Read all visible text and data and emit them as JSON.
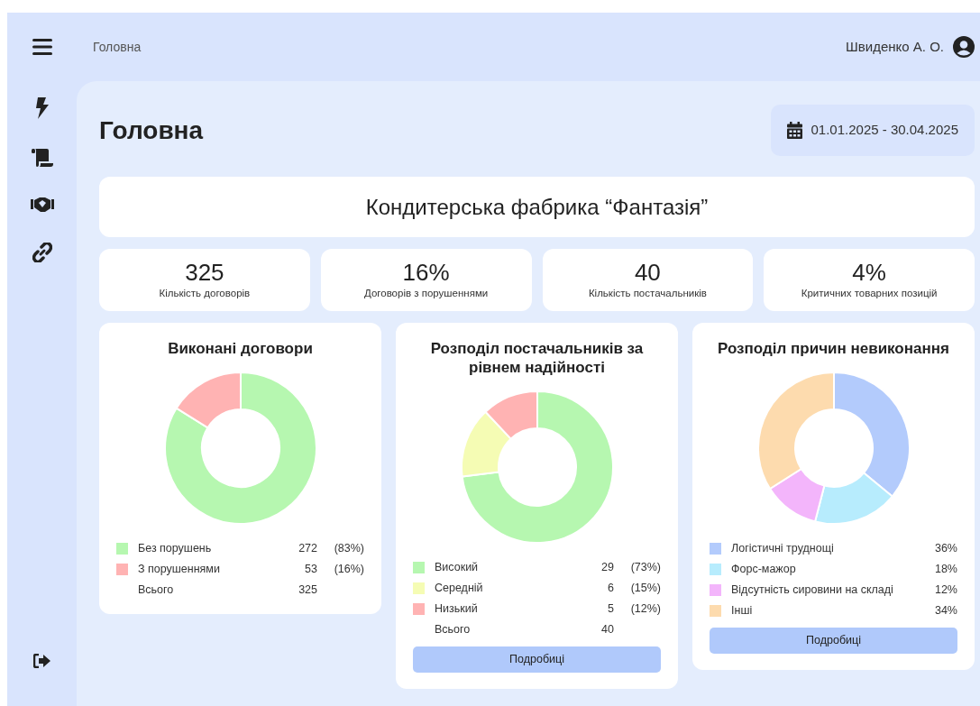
{
  "header": {
    "breadcrumb": "Головна",
    "user": "Швиденко А. О."
  },
  "page": {
    "title": "Головна",
    "date_range": "01.01.2025 - 30.04.2025"
  },
  "company": "Кондитерська фабрика “Фантазія”",
  "stats": [
    {
      "value": "325",
      "label": "Кількість договорів"
    },
    {
      "value": "16%",
      "label": "Договорів з порушеннями"
    },
    {
      "value": "40",
      "label": "Кількість постачальників"
    },
    {
      "value": "4%",
      "label": "Критичних товарних позицій"
    }
  ],
  "cards": [
    {
      "title": "Виконані договори",
      "chart_data": {
        "type": "donut",
        "categories": [
          "Без порушень",
          "З порушеннями"
        ],
        "values": [
          83,
          16
        ]
      },
      "legend": [
        {
          "color": "#b6f7b0",
          "count": "272",
          "percent": "(83%)"
        },
        {
          "color": "#ffb3b3",
          "count": "53",
          "percent": "(16%)"
        }
      ],
      "total": {
        "label": "Всього",
        "count": "325"
      }
    },
    {
      "title": "Розподіл постачальників за рівнем надійності",
      "chart_data": {
        "type": "donut",
        "categories": [
          "Високий",
          "Середній",
          "Низький"
        ],
        "values": [
          73,
          15,
          12
        ]
      },
      "legend": [
        {
          "color": "#b6f7b0",
          "count": "29",
          "percent": "(73%)"
        },
        {
          "color": "#f5fcb4",
          "count": "6",
          "percent": "(15%)"
        },
        {
          "color": "#ffb3b3",
          "count": "5",
          "percent": "(12%)"
        }
      ],
      "total": {
        "label": "Всього",
        "count": "40"
      },
      "button": "Подробиці"
    },
    {
      "title": "Розподіл причин невиконання",
      "chart_data": {
        "type": "donut",
        "categories": [
          "Логістичні труднощі",
          "Форс-мажор",
          "Відсутність сировини на складі",
          "Інші"
        ],
        "values": [
          36,
          18,
          12,
          34
        ]
      },
      "legend": [
        {
          "color": "#b3cbfc",
          "percent": "36%"
        },
        {
          "color": "#b7ecfd",
          "percent": "18%"
        },
        {
          "color": "#f3b5fb",
          "percent": "12%"
        },
        {
          "color": "#fddbae",
          "percent": "34%"
        }
      ],
      "button": "Подробиці"
    }
  ]
}
